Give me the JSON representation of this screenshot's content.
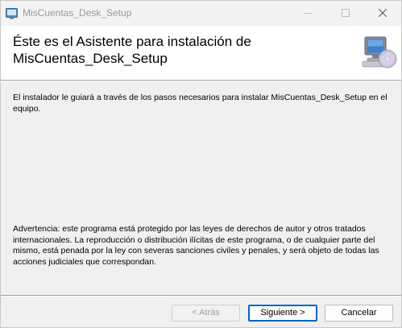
{
  "window": {
    "title": "MisCuentas_Desk_Setup"
  },
  "header": {
    "title": "Éste es el Asistente para instalación de MisCuentas_Desk_Setup",
    "icon": "computer-cd-icon"
  },
  "body": {
    "intro_text": "El instalador le guiará a través de los pasos necesarios para instalar MisCuentas_Desk_Setup en el equipo.",
    "warning_text": "Advertencia: este programa está protegido por las leyes de derechos de autor y otros tratados internacionales. La reproducción o distribución ilícitas de este programa, o de cualquier parte del mismo, está penada por la ley con severas sanciones civiles y penales, y será objeto de todas las acciones judiciales que correspondan."
  },
  "buttons": {
    "back_label": "< Atrás",
    "next_label": "Siguiente >",
    "cancel_label": "Cancelar"
  },
  "colors": {
    "accent": "#0067c0",
    "disabled_text": "#a0a0a0"
  }
}
